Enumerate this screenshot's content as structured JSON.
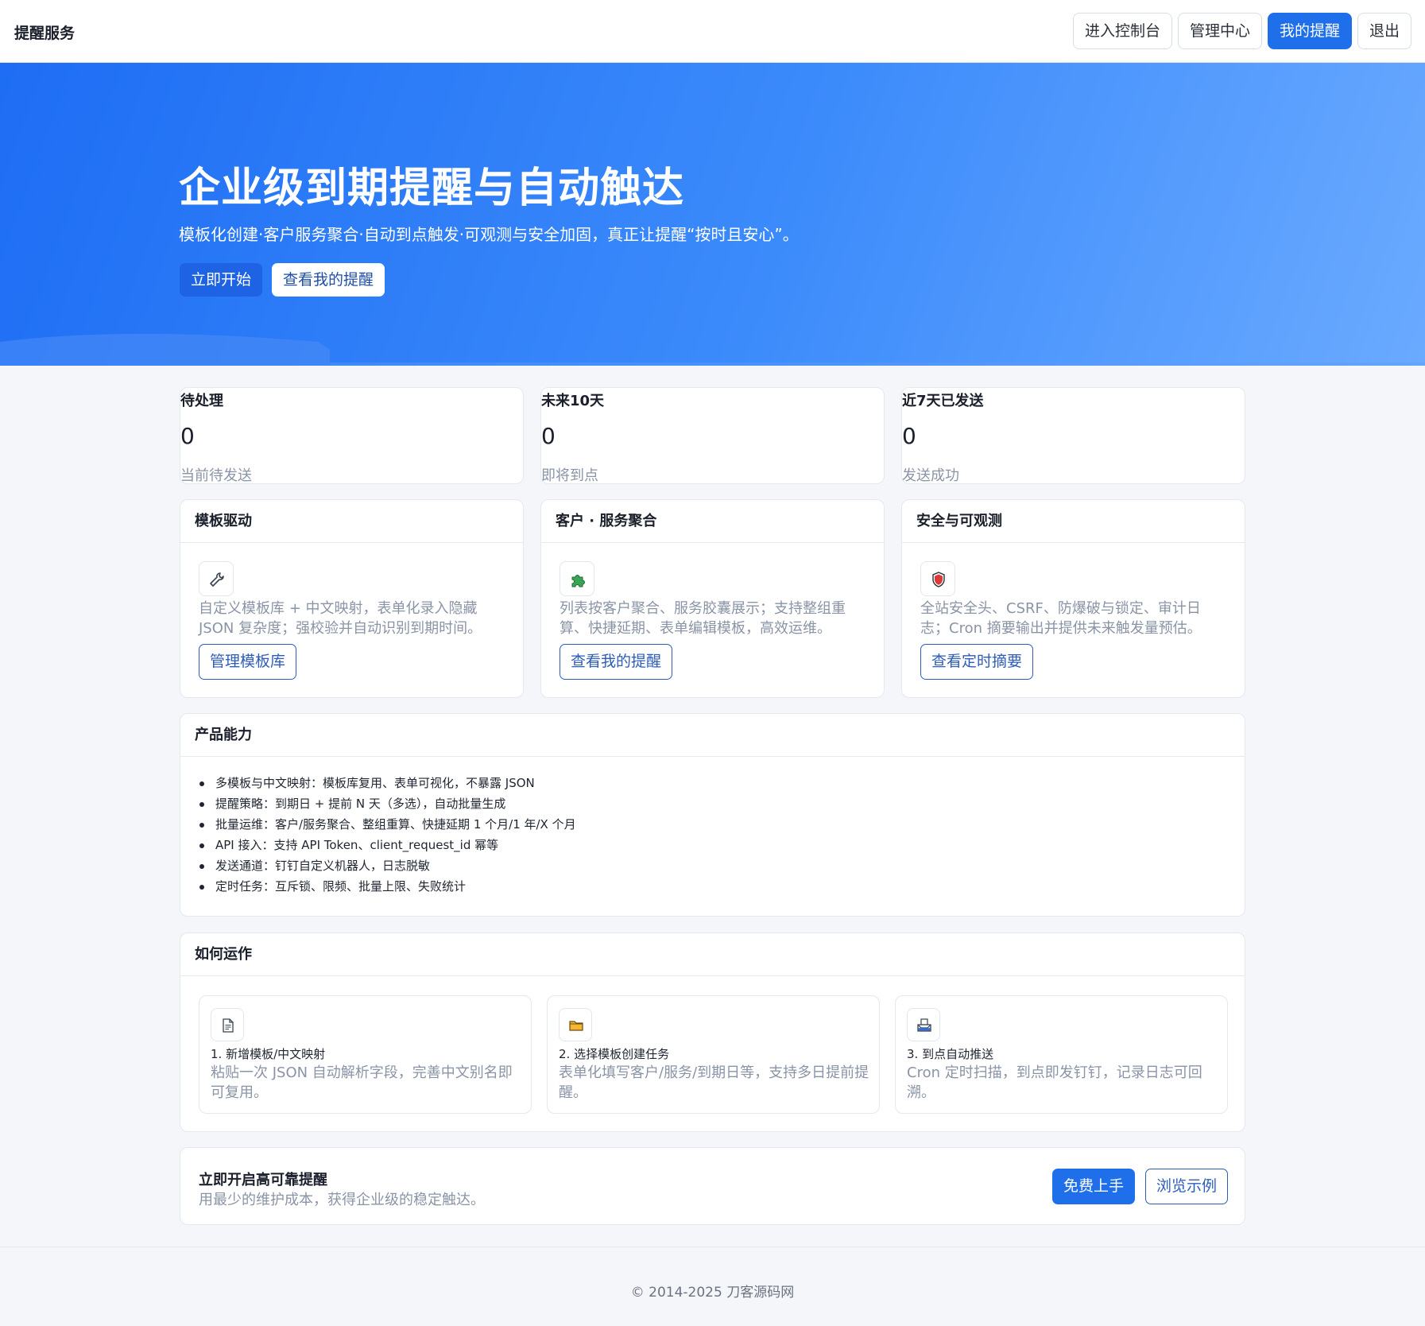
{
  "nav": {
    "brand": "提醒服务",
    "buttons": [
      {
        "label": "进入控制台"
      },
      {
        "label": "管理中心"
      },
      {
        "label": "我的提醒"
      },
      {
        "label": "退出"
      }
    ],
    "active_label": "我的提醒"
  },
  "hero": {
    "title": "企业级到期提醒与自动触达",
    "subtitle": "模板化创建·客户服务聚合·自动到点触发·可观测与安全加固，真正让提醒“按时且安心”。",
    "primary_button": "立即开始",
    "secondary_button": "查看我的提醒"
  },
  "stats": [
    {
      "label": "待处理",
      "value": "0",
      "note": "当前待发送"
    },
    {
      "label": "未来10天",
      "value": "0",
      "note": "即将到点"
    },
    {
      "label": "近7天已发送",
      "value": "0",
      "note": "发送成功"
    }
  ],
  "features": [
    {
      "title": "模板驱动",
      "icon": "wrench-icon",
      "desc": "自定义模板库 + 中文映射，表单化录入隐藏 JSON 复杂度；强校验并自动识别到期时间。",
      "button": "管理模板库"
    },
    {
      "title": "客户 · 服务聚合",
      "icon": "puzzle-icon",
      "desc": "列表按客户聚合、服务胶囊展示；支持整组重算、快捷延期、表单编辑模板，高效运维。",
      "button": "查看我的提醒"
    },
    {
      "title": "安全与可观测",
      "icon": "shield-icon",
      "desc": "全站安全头、CSRF、防爆破与锁定、审计日志；Cron 摘要输出并提供未来触发量预估。",
      "button": "查看定时摘要"
    }
  ],
  "capabilities": {
    "title": "产品能力",
    "items": [
      "多模板与中文映射：模板库复用、表单可视化，不暴露 JSON",
      "提醒策略：到期日 + 提前 N 天（多选），自动批量生成",
      "批量运维：客户/服务聚合、整组重算、快捷延期 1 个月/1 年/X 个月",
      "API 接入：支持 API Token、client_request_id 幂等",
      "发送通道：钉钉自定义机器人，日志脱敏",
      "定时任务：互斥锁、限频、批量上限、失败统计"
    ]
  },
  "how": {
    "title": "如何运作",
    "steps": [
      {
        "icon": "document-icon",
        "title": "1. 新增模板/中文映射",
        "desc": "粘贴一次 JSON 自动解析字段，完善中文别名即可复用。"
      },
      {
        "icon": "folder-icon",
        "title": "2. 选择模板创建任务",
        "desc": "表单化填写客户/服务/到期日等，支持多日提前提醒。"
      },
      {
        "icon": "inbox-icon",
        "title": "3. 到点自动推送",
        "desc": "Cron 定时扫描，到点即发钉钉，记录日志可回溯。"
      }
    ]
  },
  "cta": {
    "title": "立即开启高可靠提醒",
    "subtitle": "用最少的维护成本，获得企业级的稳定触达。",
    "primary_button": "免费上手",
    "secondary_button": "浏览示例"
  },
  "footer": {
    "text": "© 2014-2025 刀客源码网"
  },
  "colors": {
    "accent": "#1f6feb",
    "hero_start": "#1e6df4",
    "hero_end": "#6aaaff",
    "muted_text": "#8a94a6",
    "outline_button": "#2e5db8"
  }
}
